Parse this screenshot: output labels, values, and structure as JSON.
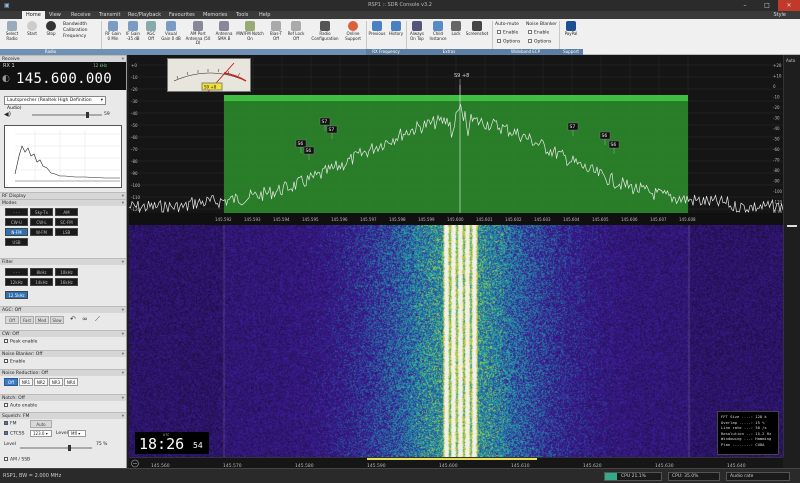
{
  "window": {
    "title": "RSP1 :: SDR Console v3.2"
  },
  "menu": {
    "items": [
      "Home",
      "View",
      "Receive",
      "Transmit",
      "Rec/Playback",
      "Favourites",
      "Memories",
      "Tools",
      "Help"
    ],
    "style_label": "Style"
  },
  "ribbon": {
    "buttons": [
      {
        "name": "select-radio",
        "label": "Select Radio",
        "icon": "radio-icon"
      },
      {
        "name": "start",
        "label": "Start",
        "icon": "play-icon"
      },
      {
        "name": "stop",
        "label": "Stop",
        "icon": "stop-icon"
      },
      {
        "name": "rf-gain",
        "label": "RF Gain 0 Min",
        "icon": "gain-icon"
      },
      {
        "name": "if-gain",
        "label": "IF Gain -35 dB",
        "icon": "gain-icon"
      },
      {
        "name": "agc",
        "label": "AGC Off",
        "icon": "agc-icon"
      },
      {
        "name": "visual-gain",
        "label": "Visual Gain 0 dB",
        "icon": "gain-icon"
      },
      {
        "name": "am-port",
        "label": "AM Port Antenna (50 Ω)",
        "icon": "antenna-icon"
      },
      {
        "name": "antenna",
        "label": "Antenna SMA B",
        "icon": "antenna-icon"
      },
      {
        "name": "mw-fm-notch",
        "label": "MW/FM Notch On",
        "icon": "notch-icon"
      },
      {
        "name": "bias-t",
        "label": "Bias-T Off",
        "icon": "biast-icon"
      },
      {
        "name": "ref-lock",
        "label": "Ref Lock Off",
        "icon": "lock-icon"
      },
      {
        "name": "radio-config",
        "label": "Radio Configuration",
        "icon": "config-icon"
      },
      {
        "name": "online-support",
        "label": "Online Support",
        "icon": "support-icon"
      },
      {
        "name": "previous",
        "label": "Previous",
        "icon": "undo-icon"
      },
      {
        "name": "history",
        "label": "History",
        "icon": "history-icon"
      },
      {
        "name": "always-on-top",
        "label": "Always On Top",
        "icon": "pin-icon"
      },
      {
        "name": "child-instance",
        "label": "Child Instance",
        "icon": "child-icon"
      },
      {
        "name": "lock",
        "label": "Lock",
        "icon": "padlock-icon"
      },
      {
        "name": "screenshot",
        "label": "Screenshot",
        "icon": "camera-icon"
      },
      {
        "name": "paypal",
        "label": "PayPal",
        "icon": "paypal-icon"
      }
    ],
    "bandwidth_items": [
      "Bandwidth",
      "Calibration",
      "Frequency"
    ],
    "auto_mute": {
      "title": "Auto-mute",
      "items": [
        "Enable",
        "Options"
      ]
    },
    "noise_blanker": {
      "title": "Noise Blanker",
      "items": [
        "Enable",
        "Options"
      ]
    },
    "groups": [
      "Radio",
      "RX Frequency",
      "Extras",
      "Wideband ECP",
      "Support"
    ]
  },
  "left_panel": {
    "receive_header": "Receive",
    "rx_label": "RX 1",
    "freq_step": "12 kHz",
    "frequency": "145.600.000",
    "audio_device": "Lautsprecher (Realtek High Definition Audio)",
    "volume_value": "59",
    "volume_level": 0.8,
    "rf_display_header": "RF Display",
    "modes_header": "Modes",
    "modes": [
      [
        "· · ·",
        "Sky-Tx",
        "AM"
      ],
      [
        "CW-U",
        "CW-L",
        "SC-FM"
      ],
      [
        "N-FM",
        "W-FM",
        "LSB"
      ],
      [
        "USB",
        "",
        ""
      ]
    ],
    "selected_mode": "N-FM",
    "filter_header": "Filter",
    "filters": [
      [
        "· · ·",
        "8kHz",
        "10kHz"
      ],
      [
        "12kHz",
        "14kHz",
        "16kHz"
      ],
      [
        "12.5kHz",
        "",
        ""
      ]
    ],
    "selected_filter": "12.5kHz",
    "agc_header": "AGC: Off",
    "agc_buttons": [
      "Off",
      "Fast",
      "Med",
      "Slow"
    ],
    "cw_header": "CW: Off",
    "cw_peak": "Peak enable",
    "nb_header": "Noise Blanker: Off",
    "nb_enable": "Enable",
    "nr_header": "Noise Reduction: Off",
    "nr_buttons": [
      "Off",
      "NR1",
      "NR2",
      "NR3",
      "NR4"
    ],
    "selected_nr": "Off",
    "notch_header": "Notch: Off",
    "notch_auto": "Auto enable",
    "squelch_header": "Squelch: FM",
    "squelch_fm": "FM",
    "squelch_auto": "Auto",
    "ctcss_label": "CTCSS",
    "ctcss_value": "123.0",
    "ctcss_level_label": "Level",
    "ctcss_level_value": "Mfl",
    "level_label": "Level",
    "level_value": "75 %",
    "amssb_label": "AM / SSB"
  },
  "spectrum": {
    "smeter_label": "S9 +8",
    "smeter_readout": "S9 +8",
    "db_labels_left": [
      "+0",
      "-10",
      "-20",
      "-30",
      "-40",
      "-50",
      "-60",
      "-70",
      "-80",
      "-90",
      "-100",
      "-110",
      "-120"
    ],
    "db_labels_right": [
      "+20",
      "+10",
      "0",
      "-10",
      "-20",
      "-30",
      "-40",
      "-50",
      "-60",
      "-70",
      "-80",
      "-90",
      "-100",
      "-110",
      "-120"
    ],
    "freq_labels": [
      "145.592",
      "145.593",
      "145.594",
      "145.595",
      "145.596",
      "145.597",
      "145.598",
      "145.599",
      "145.600",
      "145.601",
      "145.602",
      "145.603",
      "145.604",
      "145.605",
      "145.606",
      "145.607",
      "145.608"
    ],
    "s_markers": [
      "S6",
      "S6",
      "S7",
      "S7",
      "S7",
      "S6",
      "S6"
    ],
    "auto_label": "Auto",
    "accent": "#2fa52f"
  },
  "waterfall": {
    "freq_labels": [
      "145.560",
      "145.570",
      "145.580",
      "145.590",
      "145.600",
      "145.610",
      "145.620",
      "145.630",
      "145.640"
    ],
    "clock_time": "18:26",
    "clock_sec": "54",
    "clock_label": "UTC",
    "fft_info": [
      "FFT Size ....: 128 k",
      "Overlap .....: 15 %",
      "Line rate ...: 30 /s",
      "Resolution ..: 15.2 Hz",
      "Windowing ...: Hamming",
      "Plan ........: CUDA"
    ]
  },
  "statusbar": {
    "left": "RSP1, BW = 2.000 MHz",
    "cpu": "CPU 21.1%",
    "cpu2": "CPU: 35.0%",
    "audio": "Audio rate"
  }
}
